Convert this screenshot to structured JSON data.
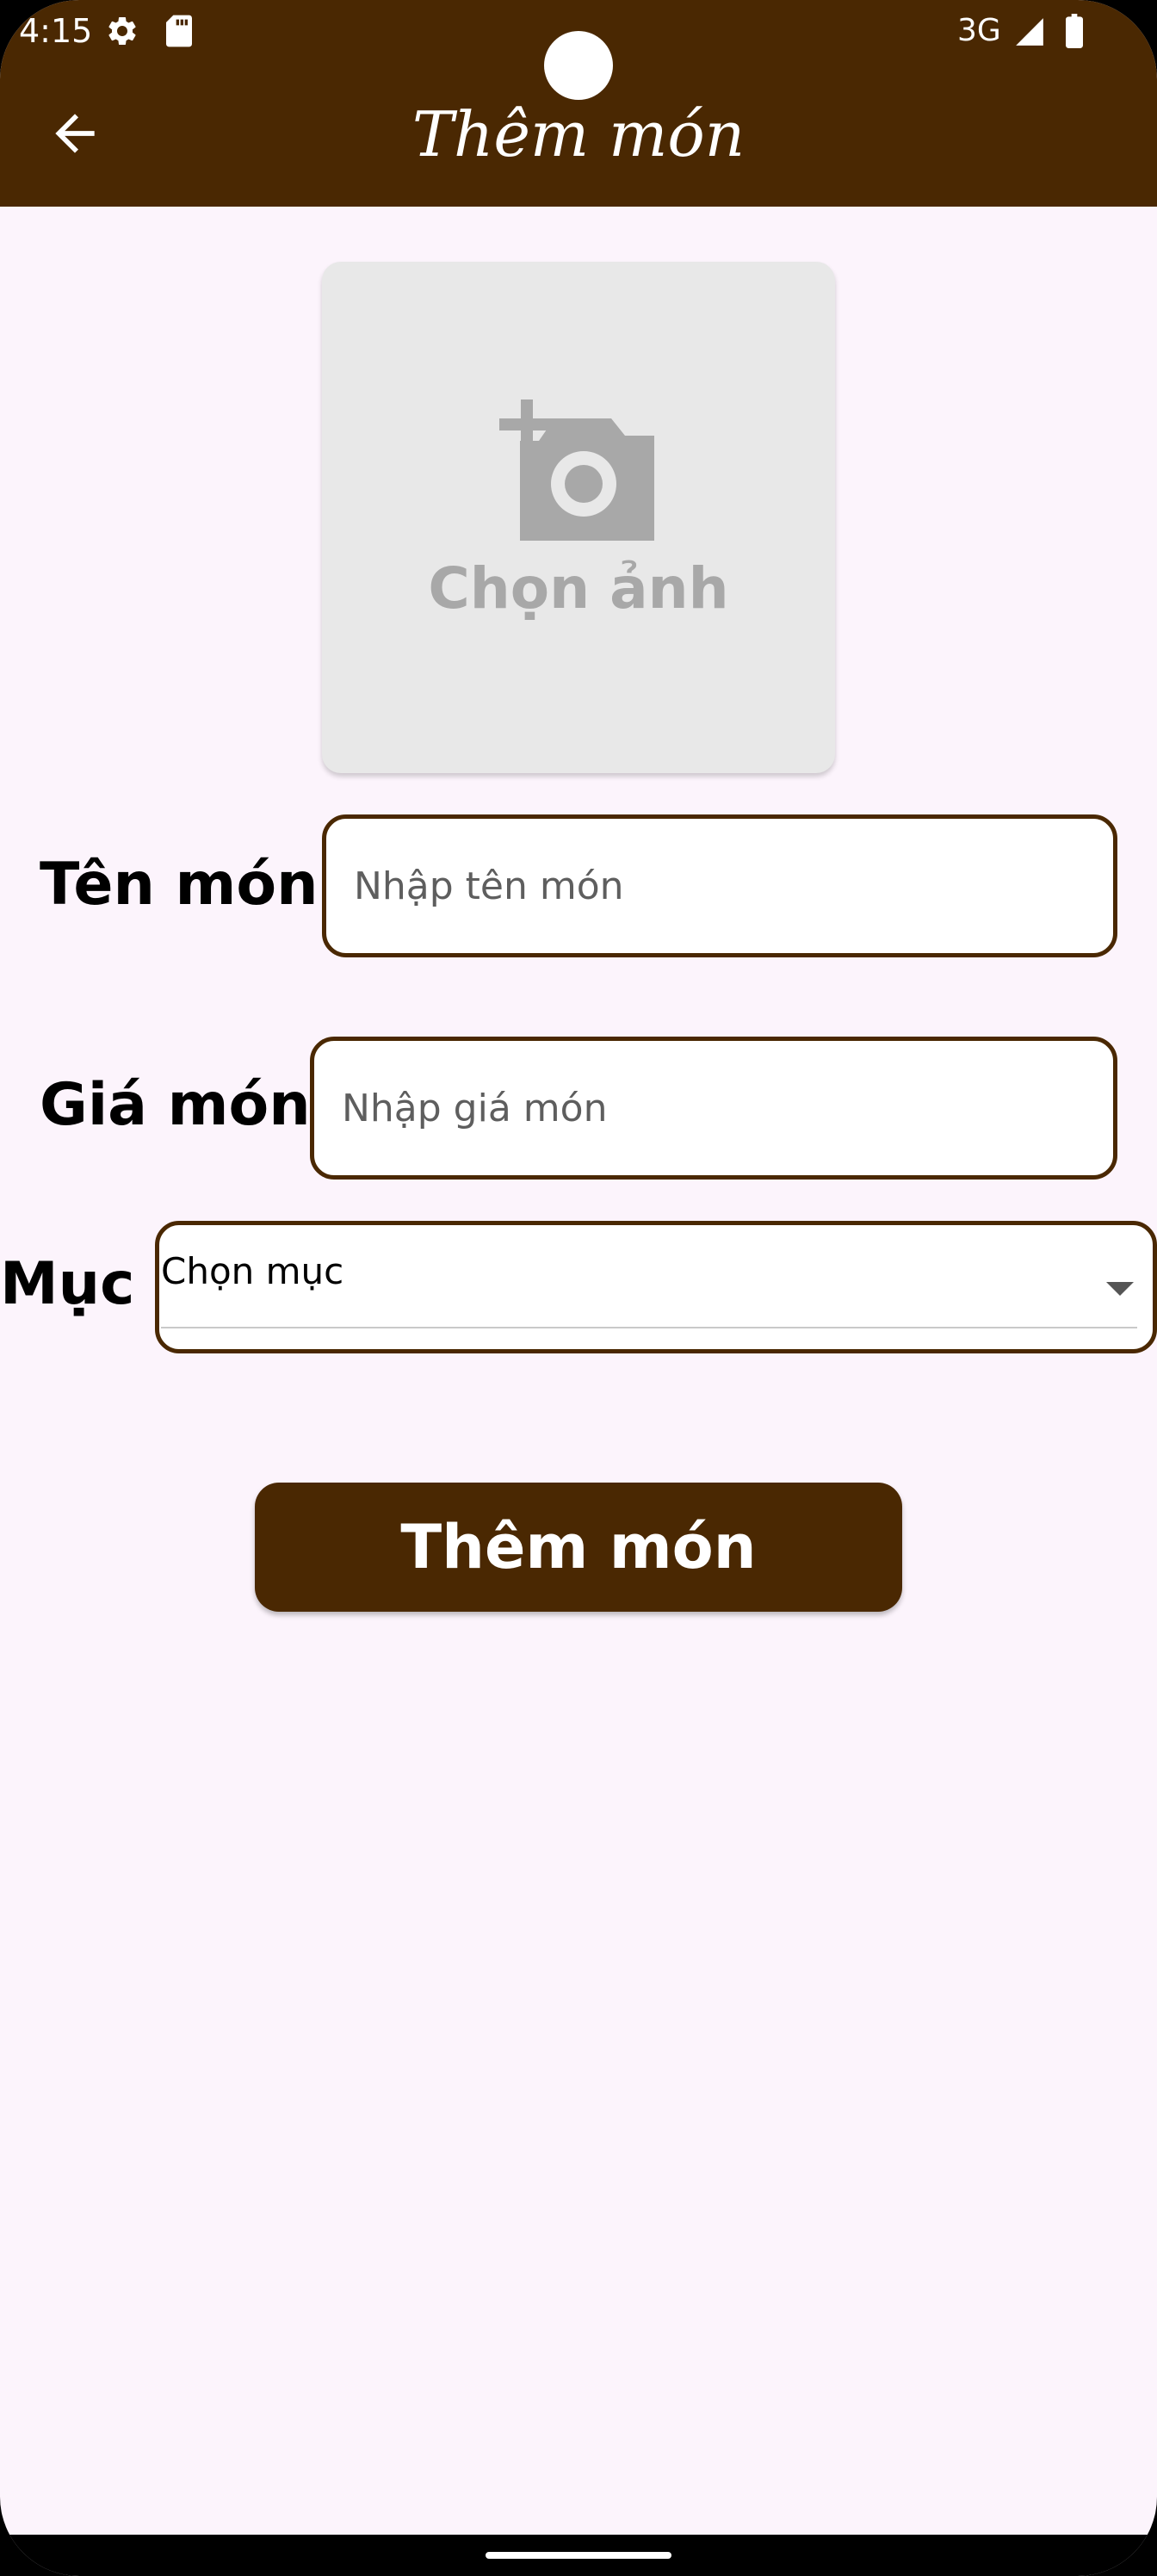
{
  "status_bar": {
    "time": "4:15",
    "network": "3G",
    "icons": [
      "gear-icon",
      "sd-card-icon",
      "signal-icon",
      "battery-icon"
    ]
  },
  "app_bar": {
    "title": "Thêm món",
    "back_icon": "arrow-back-icon",
    "background": "#4a2802"
  },
  "image_picker": {
    "label": "Chọn ảnh",
    "icon": "add-photo-icon"
  },
  "form": {
    "name_label": "Tên món",
    "name_placeholder": "Nhập tên món",
    "name_value": "",
    "price_label": "Giá món",
    "price_placeholder": "Nhập giá món",
    "price_value": "",
    "category_label": "Mục",
    "category_selected": "Chọn mục"
  },
  "submit_label": "Thêm món",
  "colors": {
    "primary": "#4a2802",
    "background": "#fcf4fc",
    "picker_bg": "#e8e8e8",
    "picker_fg": "#a8a8a8"
  }
}
